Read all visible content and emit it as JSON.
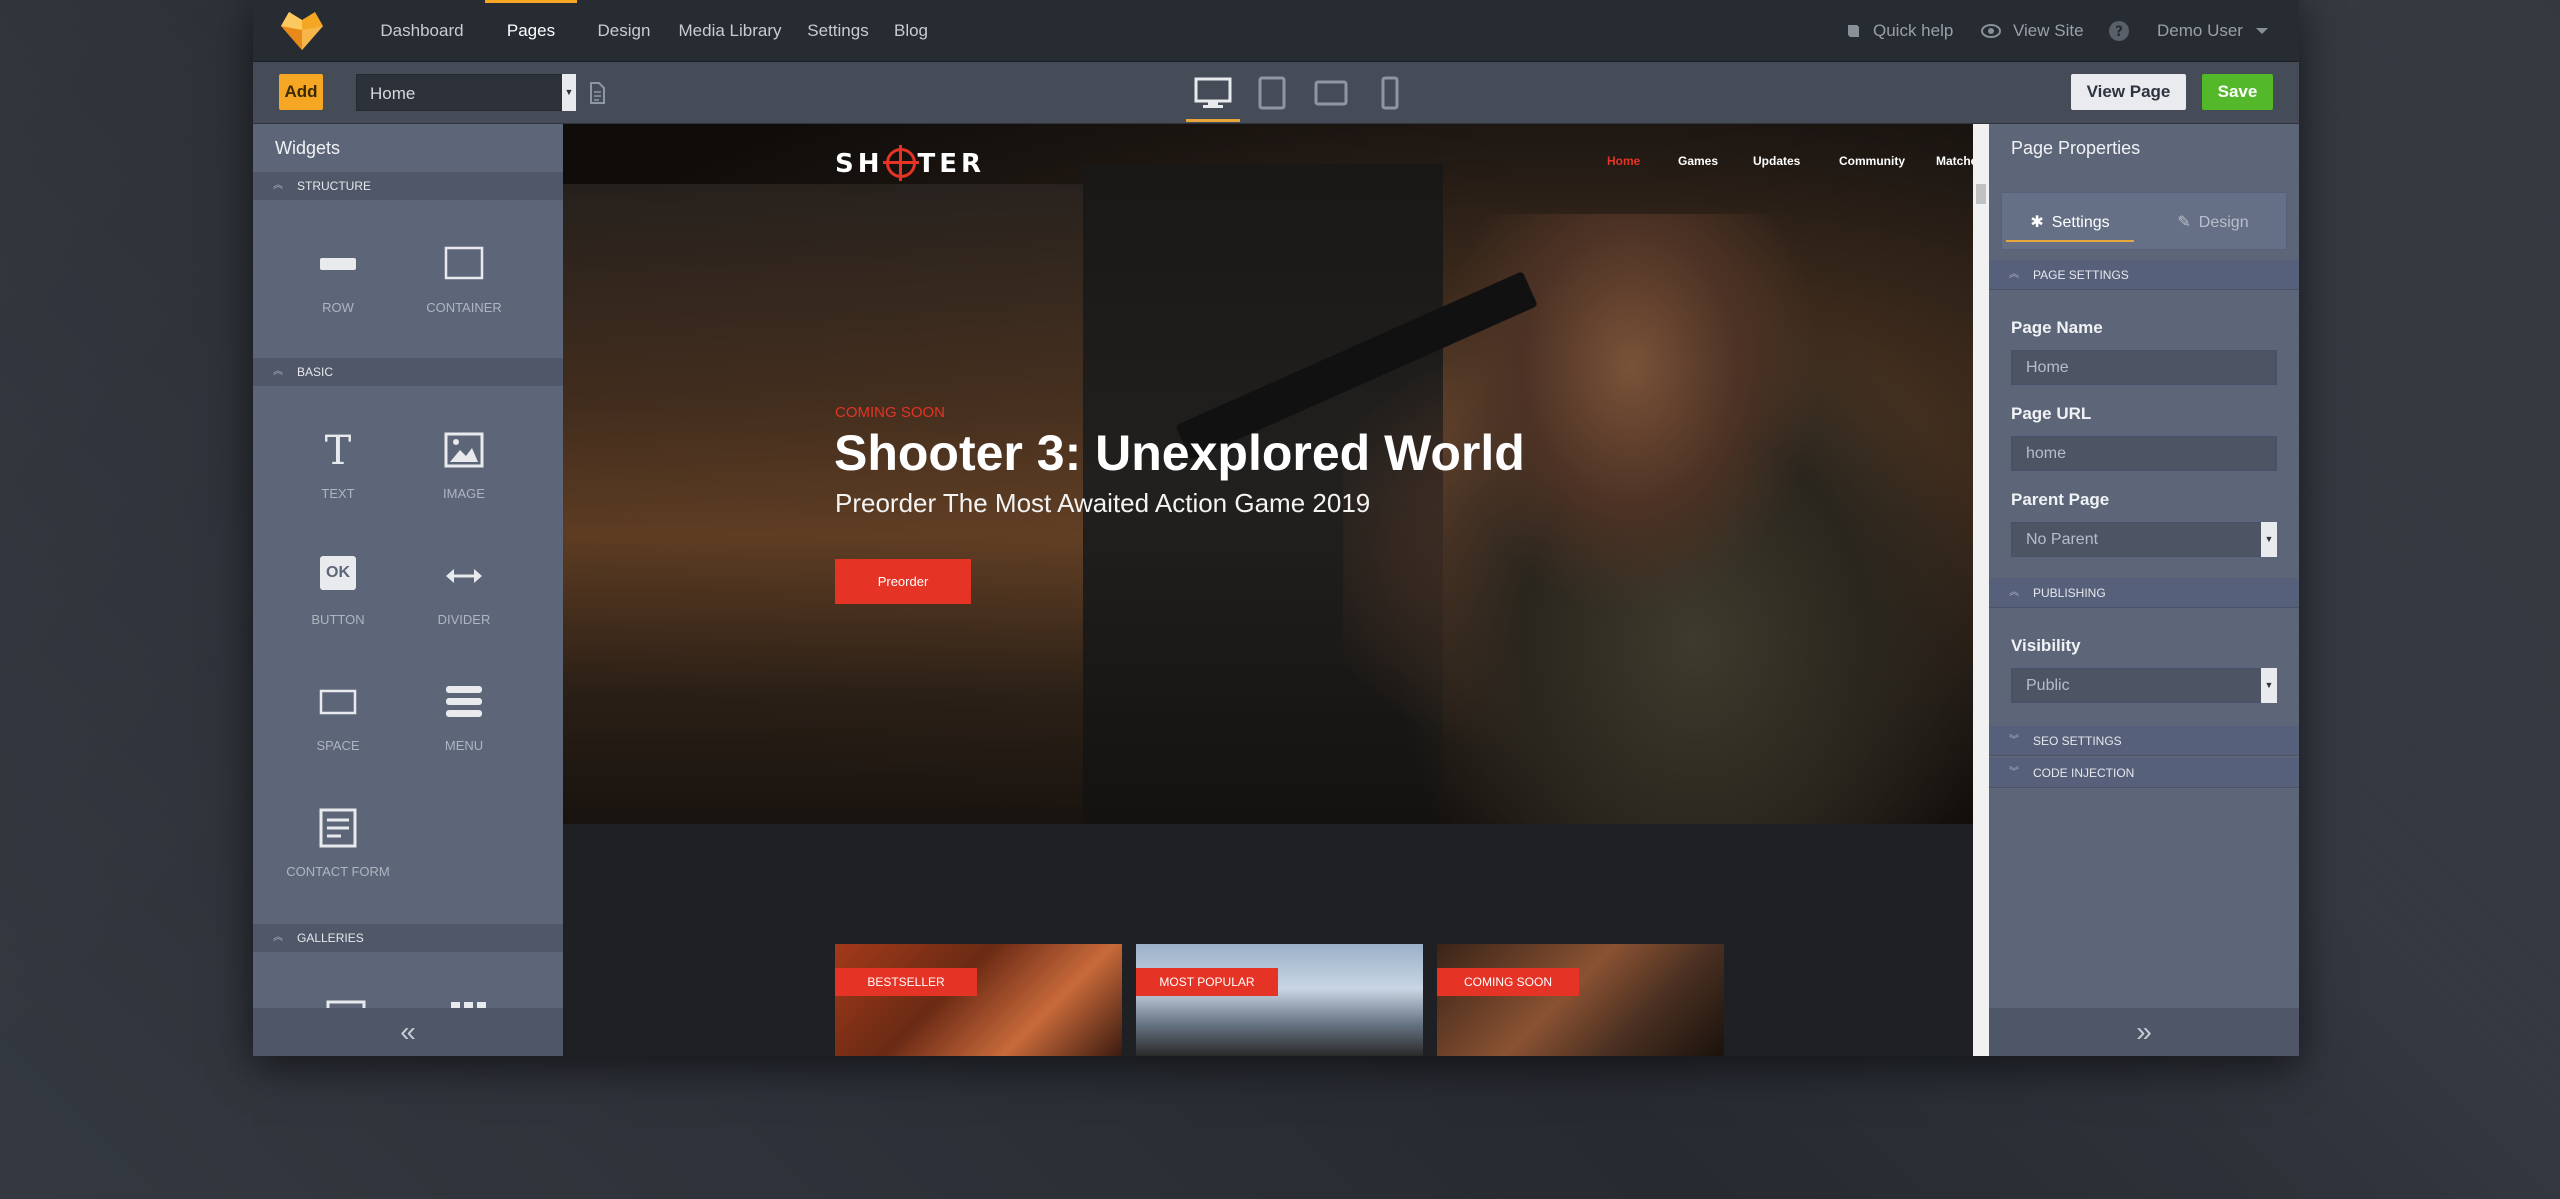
{
  "topnav": {
    "items": [
      {
        "label": "Dashboard",
        "active": false
      },
      {
        "label": "Pages",
        "active": true
      },
      {
        "label": "Design",
        "active": false
      },
      {
        "label": "Media Library",
        "active": false
      },
      {
        "label": "Settings",
        "active": false
      },
      {
        "label": "Blog",
        "active": false
      }
    ],
    "quick_help": "Quick help",
    "view_site": "View Site",
    "user": "Demo User"
  },
  "toolbar": {
    "add_label": "Add",
    "page_select_value": "Home",
    "devices": [
      "desktop-icon",
      "tablet-icon",
      "tablet-landscape-icon",
      "mobile-icon"
    ],
    "view_page_label": "View Page",
    "save_label": "Save"
  },
  "left_panel": {
    "title": "Widgets",
    "sections": {
      "structure": "STRUCTURE",
      "basic": "BASIC",
      "galleries": "GALLERIES"
    },
    "widgets": {
      "row": "ROW",
      "container": "CONTAINER",
      "text": "TEXT",
      "image": "IMAGE",
      "button": "BUTTON",
      "button_icon_text": "OK",
      "divider": "DIVIDER",
      "space": "SPACE",
      "menu": "MENU",
      "contact_form": "CONTACT FORM"
    },
    "collapse_glyph": "«"
  },
  "site": {
    "logo_left": "SH",
    "logo_right": "TER",
    "nav": [
      {
        "label": "Home",
        "active": true
      },
      {
        "label": "Games",
        "active": false
      },
      {
        "label": "Updates",
        "active": false
      },
      {
        "label": "Community",
        "active": false
      },
      {
        "label": "Matches",
        "active": false
      }
    ],
    "coming_soon": "COMING SOON",
    "hero_title": "Shooter 3: Unexplored World",
    "hero_subtitle": "Preorder The Most Awaited Action Game 2019",
    "preorder_label": "Preorder",
    "cards": [
      {
        "badge": "BESTSELLER"
      },
      {
        "badge": "MOST POPULAR"
      },
      {
        "badge": "COMING SOON"
      }
    ]
  },
  "right_panel": {
    "title": "Page Properties",
    "tab_settings": "Settings",
    "tab_design": "Design",
    "section_page_settings": "PAGE SETTINGS",
    "page_name_label": "Page Name",
    "page_name_value": "Home",
    "page_url_label": "Page URL",
    "page_url_value": "home",
    "parent_page_label": "Parent Page",
    "parent_page_value": "No Parent",
    "section_publishing": "PUBLISHING",
    "visibility_label": "Visibility",
    "visibility_value": "Public",
    "section_seo": "SEO SETTINGS",
    "section_code": "CODE INJECTION",
    "expand_glyph": "»"
  },
  "colors": {
    "accent": "#f5a623",
    "save": "#53b92a",
    "site_red": "#e53325"
  }
}
